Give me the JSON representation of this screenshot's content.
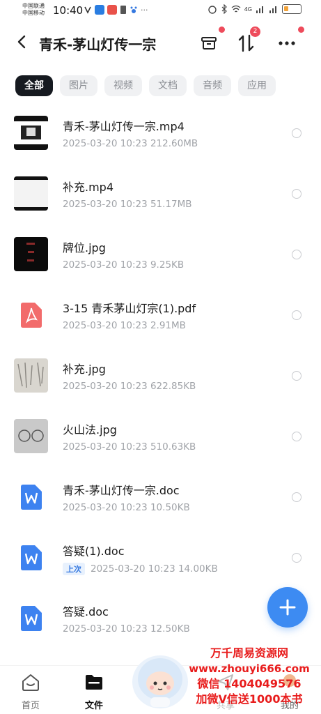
{
  "status": {
    "carrier1": "中国联通",
    "carrier2": "中国移动",
    "time": "10:40",
    "network": "4G",
    "colors": {
      "battery": "#f2a33a"
    }
  },
  "header": {
    "title": "青禾-茅山灯传一宗",
    "sort_badge": "2",
    "icons": [
      "back-icon",
      "archive-icon",
      "sort-icon",
      "more-icon"
    ]
  },
  "filters": [
    {
      "label": "全部",
      "active": true
    },
    {
      "label": "图片",
      "active": false
    },
    {
      "label": "视频",
      "active": false
    },
    {
      "label": "文档",
      "active": false
    },
    {
      "label": "音频",
      "active": false
    },
    {
      "label": "应用",
      "active": false
    }
  ],
  "files": [
    {
      "name": "青禾-茅山灯传一宗.mp4",
      "date": "2025-03-20",
      "time": "10:23",
      "size": "212.60MB",
      "kind": "video-thumb"
    },
    {
      "name": "补充.mp4",
      "date": "2025-03-20",
      "time": "10:23",
      "size": "51.17MB",
      "kind": "video-thumb"
    },
    {
      "name": "牌位.jpg",
      "date": "2025-03-20",
      "time": "10:23",
      "size": "9.25KB",
      "kind": "image-thumb"
    },
    {
      "name": "3-15 青禾茅山灯宗(1).pdf",
      "date": "2025-03-20",
      "time": "10:23",
      "size": "2.91MB",
      "kind": "pdf-icon"
    },
    {
      "name": "补充.jpg",
      "date": "2025-03-20",
      "time": "10:23",
      "size": "622.85KB",
      "kind": "image-thumb"
    },
    {
      "name": "火山法.jpg",
      "date": "2025-03-20",
      "time": "10:23",
      "size": "510.63KB",
      "kind": "image-thumb"
    },
    {
      "name": "青禾-茅山灯传一宗.doc",
      "date": "2025-03-20",
      "time": "10:23",
      "size": "10.50KB",
      "kind": "word-icon"
    },
    {
      "name": "答疑(1).doc",
      "date": "2025-03-20",
      "time": "10:23",
      "size": "14.00KB",
      "kind": "word-icon",
      "tag": "上次"
    },
    {
      "name": "答疑.doc",
      "date": "2025-03-20",
      "time": "10:23",
      "size": "12.50KB",
      "kind": "word-icon"
    }
  ],
  "fab": {
    "icon": "plus-icon",
    "label": "+"
  },
  "nav": [
    {
      "label": "首页",
      "icon": "home-icon",
      "active": false
    },
    {
      "label": "文件",
      "icon": "folder-icon",
      "active": true
    },
    {
      "label": "共享",
      "icon": "share-icon",
      "active": false
    },
    {
      "label": "我的",
      "icon": "profile-icon",
      "active": false
    }
  ],
  "watermark": {
    "line1": "万千周易资源网",
    "line2": "www.zhouyi666.com",
    "line3": "微信 1404049576",
    "line4": "加微V信送1000本书"
  },
  "colors": {
    "accent": "#3d8bf2",
    "badge": "#ee4b5b",
    "chip_active": "#161a20",
    "watermark": "#e81c1c"
  }
}
